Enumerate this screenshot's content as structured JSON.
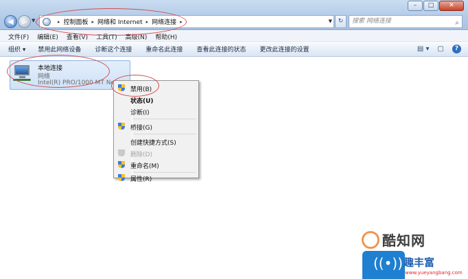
{
  "window": {
    "minimize": "–",
    "maximize": "□",
    "close": "✕"
  },
  "nav": {
    "back": "◀",
    "forward": "▶",
    "dropdown": "▼"
  },
  "address": {
    "crumbs": [
      "控制面板",
      "网络和 Internet",
      "网络连接"
    ],
    "separator": "▸",
    "dropdown": "▼",
    "refresh": "↻"
  },
  "search": {
    "placeholder": "搜索 网络连接",
    "icon": "⌕"
  },
  "menubar": [
    "文件(F)",
    "编辑(E)",
    "查看(V)",
    "工具(T)",
    "高级(N)",
    "帮助(H)"
  ],
  "commandbar": {
    "organize": "组织 ▾",
    "items": [
      "禁用此网络设备",
      "诊断这个连接",
      "重命名此连接",
      "查看此连接的状态",
      "更改此连接的设置"
    ],
    "view_icon": "▤ ▾",
    "pane_icon": "▢",
    "help_icon": "?"
  },
  "connection": {
    "name": "本地连接",
    "type": "网络",
    "device": "Intel(R) PRO/1000 MT Netw"
  },
  "context_menu": {
    "items": [
      {
        "label": "禁用(B)",
        "shield": true,
        "bold": false,
        "disabled": false
      },
      {
        "label": "状态(U)",
        "shield": false,
        "bold": true,
        "disabled": false
      },
      {
        "label": "诊断(I)",
        "shield": false,
        "bold": false,
        "disabled": false
      },
      {
        "label": "桥接(G)",
        "shield": true,
        "bold": false,
        "disabled": false
      },
      {
        "label": "创建快捷方式(S)",
        "shield": false,
        "bold": false,
        "disabled": false
      },
      {
        "label": "删除(D)",
        "shield": true,
        "bold": false,
        "disabled": true
      },
      {
        "label": "重命名(M)",
        "shield": true,
        "bold": false,
        "disabled": false
      },
      {
        "label": "属性(R)",
        "shield": true,
        "bold": false,
        "disabled": false
      }
    ]
  },
  "watermarks": {
    "site1": "酷知网",
    "site2": "趣丰富",
    "site2_url": "www.yueyangbang.com"
  },
  "colors": {
    "annotation": "#d64a4a",
    "accent": "#3b78c4"
  }
}
